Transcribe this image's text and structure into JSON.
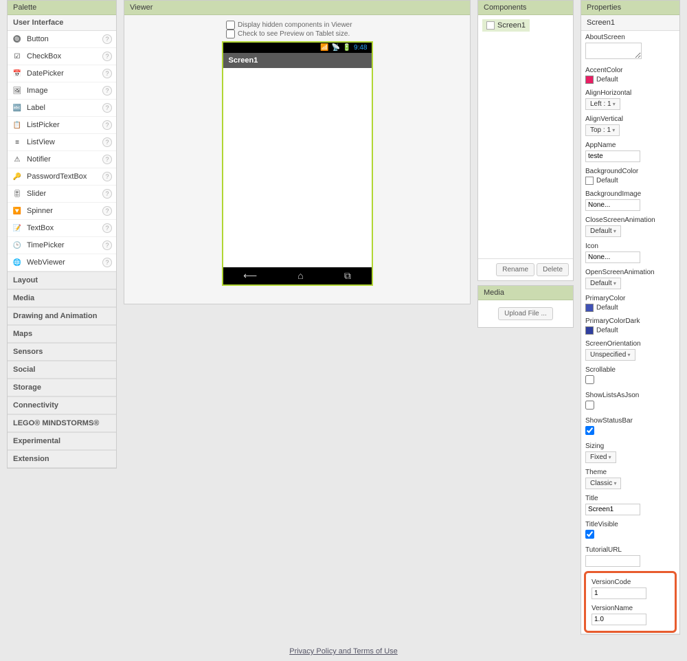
{
  "palette": {
    "header": "Palette",
    "ui_header": "User Interface",
    "items": [
      {
        "label": "Button",
        "icon": "btn"
      },
      {
        "label": "CheckBox",
        "icon": "check"
      },
      {
        "label": "DatePicker",
        "icon": "date"
      },
      {
        "label": "Image",
        "icon": "img"
      },
      {
        "label": "Label",
        "icon": "lbl"
      },
      {
        "label": "ListPicker",
        "icon": "list"
      },
      {
        "label": "ListView",
        "icon": "lview"
      },
      {
        "label": "Notifier",
        "icon": "warn"
      },
      {
        "label": "PasswordTextBox",
        "icon": "pwd"
      },
      {
        "label": "Slider",
        "icon": "sld"
      },
      {
        "label": "Spinner",
        "icon": "spin"
      },
      {
        "label": "TextBox",
        "icon": "txt"
      },
      {
        "label": "TimePicker",
        "icon": "time"
      },
      {
        "label": "WebViewer",
        "icon": "web"
      }
    ],
    "categories": [
      "Layout",
      "Media",
      "Drawing and Animation",
      "Maps",
      "Sensors",
      "Social",
      "Storage",
      "Connectivity",
      "LEGO® MINDSTORMS®",
      "Experimental",
      "Extension"
    ]
  },
  "viewer": {
    "header": "Viewer",
    "opt_hidden": "Display hidden components in Viewer",
    "opt_tablet": "Check to see Preview on Tablet size.",
    "time": "9:48",
    "screen_title": "Screen1"
  },
  "components": {
    "header": "Components",
    "root": "Screen1",
    "rename": "Rename",
    "delete": "Delete"
  },
  "media": {
    "header": "Media",
    "upload": "Upload File ..."
  },
  "properties": {
    "header": "Properties",
    "title": "Screen1",
    "items": {
      "AboutScreen": {
        "label": "AboutScreen",
        "value": ""
      },
      "AccentColor": {
        "label": "AccentColor",
        "value": "Default",
        "color": "#e91e63"
      },
      "AlignHorizontal": {
        "label": "AlignHorizontal",
        "value": "Left : 1"
      },
      "AlignVertical": {
        "label": "AlignVertical",
        "value": "Top : 1"
      },
      "AppName": {
        "label": "AppName",
        "value": "teste"
      },
      "BackgroundColor": {
        "label": "BackgroundColor",
        "value": "Default",
        "color": "#ffffff"
      },
      "BackgroundImage": {
        "label": "BackgroundImage",
        "value": "None..."
      },
      "CloseScreenAnimation": {
        "label": "CloseScreenAnimation",
        "value": "Default"
      },
      "Icon": {
        "label": "Icon",
        "value": "None..."
      },
      "OpenScreenAnimation": {
        "label": "OpenScreenAnimation",
        "value": "Default"
      },
      "PrimaryColor": {
        "label": "PrimaryColor",
        "value": "Default",
        "color": "#3f51b5"
      },
      "PrimaryColorDark": {
        "label": "PrimaryColorDark",
        "value": "Default",
        "color": "#303f9f"
      },
      "ScreenOrientation": {
        "label": "ScreenOrientation",
        "value": "Unspecified"
      },
      "Scrollable": {
        "label": "Scrollable",
        "checked": false
      },
      "ShowListsAsJson": {
        "label": "ShowListsAsJson",
        "checked": false
      },
      "ShowStatusBar": {
        "label": "ShowStatusBar",
        "checked": true
      },
      "Sizing": {
        "label": "Sizing",
        "value": "Fixed"
      },
      "Theme": {
        "label": "Theme",
        "value": "Classic"
      },
      "Title": {
        "label": "Title",
        "value": "Screen1"
      },
      "TitleVisible": {
        "label": "TitleVisible",
        "checked": true
      },
      "TutorialURL": {
        "label": "TutorialURL",
        "value": ""
      },
      "VersionCode": {
        "label": "VersionCode",
        "value": "1"
      },
      "VersionName": {
        "label": "VersionName",
        "value": "1.0"
      }
    }
  },
  "footer": {
    "link": "Privacy Policy and Terms of Use"
  }
}
